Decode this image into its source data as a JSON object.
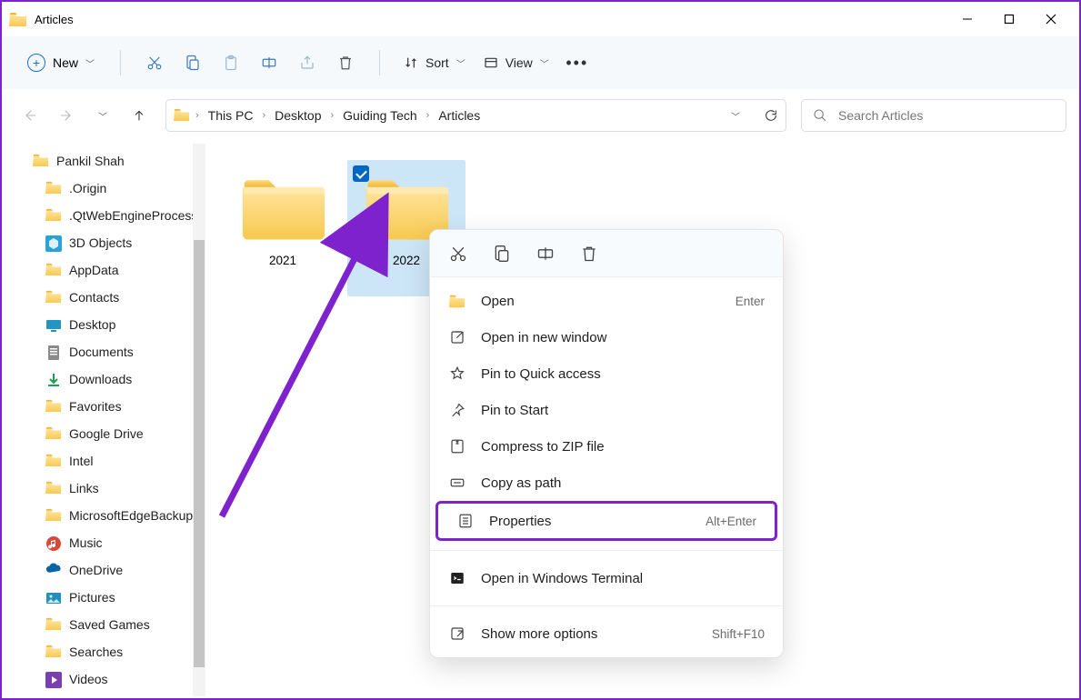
{
  "window": {
    "title": "Articles"
  },
  "toolbar": {
    "new_label": "New",
    "sort_label": "Sort",
    "view_label": "View"
  },
  "breadcrumbs": [
    "This PC",
    "Desktop",
    "Guiding Tech",
    "Articles"
  ],
  "search": {
    "placeholder": "Search Articles"
  },
  "tree": {
    "root": "Pankil Shah",
    "items": [
      {
        "label": ".Origin",
        "icon": "folder"
      },
      {
        "label": ".QtWebEngineProcess",
        "icon": "folder"
      },
      {
        "label": "3D Objects",
        "icon": "3d"
      },
      {
        "label": "AppData",
        "icon": "folder"
      },
      {
        "label": "Contacts",
        "icon": "folder"
      },
      {
        "label": "Desktop",
        "icon": "desktop"
      },
      {
        "label": "Documents",
        "icon": "documents"
      },
      {
        "label": "Downloads",
        "icon": "downloads"
      },
      {
        "label": "Favorites",
        "icon": "folder"
      },
      {
        "label": "Google Drive",
        "icon": "folder"
      },
      {
        "label": "Intel",
        "icon": "folder"
      },
      {
        "label": "Links",
        "icon": "folder"
      },
      {
        "label": "MicrosoftEdgeBackups",
        "icon": "folder"
      },
      {
        "label": "Music",
        "icon": "music"
      },
      {
        "label": "OneDrive",
        "icon": "onedrive"
      },
      {
        "label": "Pictures",
        "icon": "pictures"
      },
      {
        "label": "Saved Games",
        "icon": "folder"
      },
      {
        "label": "Searches",
        "icon": "folder"
      },
      {
        "label": "Videos",
        "icon": "videos"
      }
    ]
  },
  "folders": [
    {
      "name": "2021",
      "selected": false
    },
    {
      "name": "2022",
      "selected": true
    }
  ],
  "context_menu": {
    "items": [
      {
        "label": "Open",
        "shortcut": "Enter",
        "icon": "open"
      },
      {
        "label": "Open in new window",
        "shortcut": "",
        "icon": "new-window"
      },
      {
        "label": "Pin to Quick access",
        "shortcut": "",
        "icon": "star"
      },
      {
        "label": "Pin to Start",
        "shortcut": "",
        "icon": "pin"
      },
      {
        "label": "Compress to ZIP file",
        "shortcut": "",
        "icon": "zip"
      },
      {
        "label": "Copy as path",
        "shortcut": "",
        "icon": "path"
      },
      {
        "label": "Properties",
        "shortcut": "Alt+Enter",
        "icon": "properties",
        "highlighted": true
      },
      {
        "label": "Open in Windows Terminal",
        "shortcut": "",
        "icon": "terminal"
      },
      {
        "label": "Show more options",
        "shortcut": "Shift+F10",
        "icon": "more"
      }
    ]
  },
  "annotation": {
    "highlight_color": "#7e22ce"
  }
}
